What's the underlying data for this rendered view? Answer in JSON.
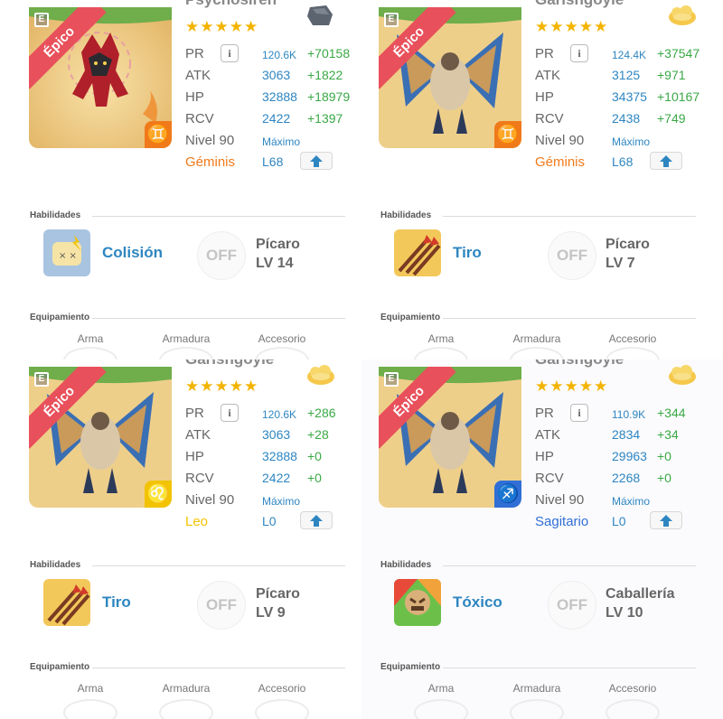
{
  "cards": [
    {
      "name": "Psychosiren",
      "edition": "E",
      "rarity": "Épico",
      "stars": "★★★★★",
      "top_icon": "gray-stone-icon",
      "element_icon": "gemini-sign-icon",
      "element_glyph": "♊",
      "element_color": "#f07a1a",
      "stats": {
        "pr": {
          "label": "PR",
          "value": "120.6K",
          "bonus": "+70158"
        },
        "atk": {
          "label": "ATK",
          "value": "3063",
          "bonus": "+1822"
        },
        "hp": {
          "label": "HP",
          "value": "32888",
          "bonus": "+18979"
        },
        "rcv": {
          "label": "RCV",
          "value": "2422",
          "bonus": "+1397"
        }
      },
      "level_label": "Nivel 90",
      "level_value": "Máximo",
      "sign": "Géminis",
      "sign_color": "#f07a1a",
      "l_level": "L68",
      "skills_title": "Habilidades",
      "skill": {
        "name": "Colisión",
        "icon": "collision-skill-icon",
        "off": "OFF",
        "role": "Pícaro",
        "lv": "LV 14"
      },
      "equip_title": "Equipamiento",
      "equip": [
        "Arma",
        "Armadura",
        "Accesorio"
      ]
    },
    {
      "name": "Garishgoyle",
      "edition": "E",
      "rarity": "Épico",
      "stars": "★★★★★",
      "top_icon": "gold-cloud-icon",
      "element_icon": "gemini-sign-icon",
      "element_glyph": "♊",
      "element_color": "#f07a1a",
      "stats": {
        "pr": {
          "label": "PR",
          "value": "124.4K",
          "bonus": "+37547"
        },
        "atk": {
          "label": "ATK",
          "value": "3125",
          "bonus": "+971"
        },
        "hp": {
          "label": "HP",
          "value": "34375",
          "bonus": "+10167"
        },
        "rcv": {
          "label": "RCV",
          "value": "2438",
          "bonus": "+749"
        }
      },
      "level_label": "Nivel 90",
      "level_value": "Máximo",
      "sign": "Géminis",
      "sign_color": "#f07a1a",
      "l_level": "L68",
      "skills_title": "Habilidades",
      "skill": {
        "name": "Tiro",
        "icon": "arrows-skill-icon",
        "off": "OFF",
        "role": "Pícaro",
        "lv": "LV 7"
      },
      "equip_title": "Equipamiento",
      "equip": [
        "Arma",
        "Armadura",
        "Accesorio"
      ]
    },
    {
      "name": "Garishgoyle",
      "edition": "E",
      "rarity": "Épico",
      "stars": "★★★★★",
      "top_icon": "gold-cloud-icon",
      "element_icon": "leo-sign-icon",
      "element_glyph": "♌",
      "element_color": "#f2c300",
      "stats": {
        "pr": {
          "label": "PR",
          "value": "120.6K",
          "bonus": "+286"
        },
        "atk": {
          "label": "ATK",
          "value": "3063",
          "bonus": "+28"
        },
        "hp": {
          "label": "HP",
          "value": "32888",
          "bonus": "+0"
        },
        "rcv": {
          "label": "RCV",
          "value": "2422",
          "bonus": "+0"
        }
      },
      "level_label": "Nivel 90",
      "level_value": "Máximo",
      "sign": "Leo",
      "sign_color": "#f2c300",
      "l_level": "L0",
      "skills_title": "Habilidades",
      "skill": {
        "name": "Tiro",
        "icon": "arrows-skill-icon",
        "off": "OFF",
        "role": "Pícaro",
        "lv": "LV 9"
      },
      "equip_title": "Equipamiento",
      "equip": [
        "Arma",
        "Armadura",
        "Accesorio"
      ]
    },
    {
      "name": "Garishgoyle",
      "edition": "E",
      "rarity": "Épico",
      "stars": "★★★★★",
      "top_icon": "gold-cloud-icon",
      "element_icon": "sagittarius-sign-icon",
      "element_glyph": "♐",
      "element_color": "#2f6fd6",
      "stats": {
        "pr": {
          "label": "PR",
          "value": "110.9K",
          "bonus": "+344"
        },
        "atk": {
          "label": "ATK",
          "value": "2834",
          "bonus": "+34"
        },
        "hp": {
          "label": "HP",
          "value": "29963",
          "bonus": "+0"
        },
        "rcv": {
          "label": "RCV",
          "value": "2268",
          "bonus": "+0"
        }
      },
      "level_label": "Nivel 90",
      "level_value": "Máximo",
      "sign": "Sagitario",
      "sign_color": "#2f6fd6",
      "l_level": "L0",
      "skills_title": "Habilidades",
      "skill": {
        "name": "Tóxico",
        "icon": "toxic-skill-icon",
        "off": "OFF",
        "role": "Caballería",
        "lv": "LV 10"
      },
      "equip_title": "Equipamiento",
      "equip": [
        "Arma",
        "Armadura",
        "Accesorio"
      ]
    }
  ]
}
